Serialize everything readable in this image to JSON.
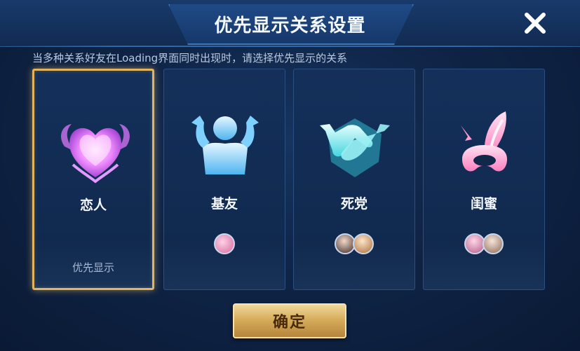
{
  "dialog": {
    "title": "优先显示关系设置",
    "subtitle": "当多种关系好友在Loading界面同时出现时，请选择优先显示的关系",
    "confirm_label": "确定",
    "close_icon": "close-icon"
  },
  "relations": [
    {
      "label": "恋人",
      "icon": "heart-icon",
      "selected": true,
      "priority_label": "优先显示",
      "avatar_count": 0,
      "color": "#f08cff"
    },
    {
      "label": "基友",
      "icon": "muscle-buddy-icon",
      "selected": false,
      "avatar_count": 1,
      "color": "#8fd8ff"
    },
    {
      "label": "死党",
      "icon": "handshake-icon",
      "selected": false,
      "avatar_count": 2,
      "color": "#79f0f4"
    },
    {
      "label": "闺蜜",
      "icon": "bunny-ears-icon",
      "selected": false,
      "avatar_count": 2,
      "color": "#ff8fc8"
    }
  ],
  "colors": {
    "accent_gold": "#e2b45e",
    "panel_bg": "#0f2446",
    "button_gold": "#d7ad5c"
  }
}
